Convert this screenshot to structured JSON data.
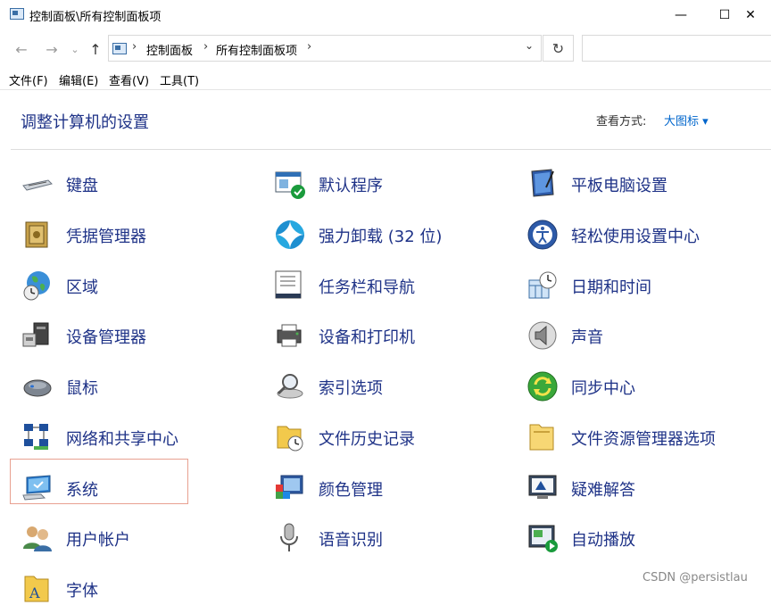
{
  "window": {
    "title": "控制面板\\所有控制面板项",
    "minimize": "—",
    "maximize": "☐",
    "close": "✕"
  },
  "address": {
    "back": "←",
    "forward": "→",
    "recent": "⌄",
    "up": "↑",
    "crumbs": [
      "控制面板",
      "所有控制面板项"
    ],
    "sep": "›",
    "dropdown": "⌄",
    "refresh": "↻"
  },
  "menu": [
    "文件(F)",
    "编辑(E)",
    "查看(V)",
    "工具(T)"
  ],
  "main": {
    "heading": "调整计算机的设置",
    "view_by_label": "查看方式:",
    "view_by_value": "大图标 ▾"
  },
  "items": [
    {
      "label": "键盘",
      "icon": "keyboard-icon"
    },
    {
      "label": "默认程序",
      "icon": "default-programs-icon"
    },
    {
      "label": "平板电脑设置",
      "icon": "tablet-settings-icon"
    },
    {
      "label": "凭据管理器",
      "icon": "credential-manager-icon"
    },
    {
      "label": "强力卸载 (32 位)",
      "icon": "uninstaller-icon"
    },
    {
      "label": "轻松使用设置中心",
      "icon": "ease-of-access-icon"
    },
    {
      "label": "区域",
      "icon": "region-icon"
    },
    {
      "label": "任务栏和导航",
      "icon": "taskbar-icon"
    },
    {
      "label": "日期和时间",
      "icon": "date-time-icon"
    },
    {
      "label": "设备管理器",
      "icon": "device-manager-icon"
    },
    {
      "label": "设备和打印机",
      "icon": "printer-icon"
    },
    {
      "label": "声音",
      "icon": "sound-icon"
    },
    {
      "label": "鼠标",
      "icon": "mouse-icon"
    },
    {
      "label": "索引选项",
      "icon": "indexing-icon"
    },
    {
      "label": "同步中心",
      "icon": "sync-center-icon"
    },
    {
      "label": "网络和共享中心",
      "icon": "network-icon"
    },
    {
      "label": "文件历史记录",
      "icon": "file-history-icon"
    },
    {
      "label": "文件资源管理器选项",
      "icon": "folder-options-icon"
    },
    {
      "label": "系统",
      "icon": "system-icon"
    },
    {
      "label": "颜色管理",
      "icon": "color-management-icon"
    },
    {
      "label": "疑难解答",
      "icon": "troubleshooting-icon"
    },
    {
      "label": "用户帐户",
      "icon": "user-accounts-icon"
    },
    {
      "label": "语音识别",
      "icon": "speech-recognition-icon"
    },
    {
      "label": "自动播放",
      "icon": "autoplay-icon"
    },
    {
      "label": "字体",
      "icon": "fonts-icon"
    }
  ],
  "watermark": "CSDN @persistlau"
}
